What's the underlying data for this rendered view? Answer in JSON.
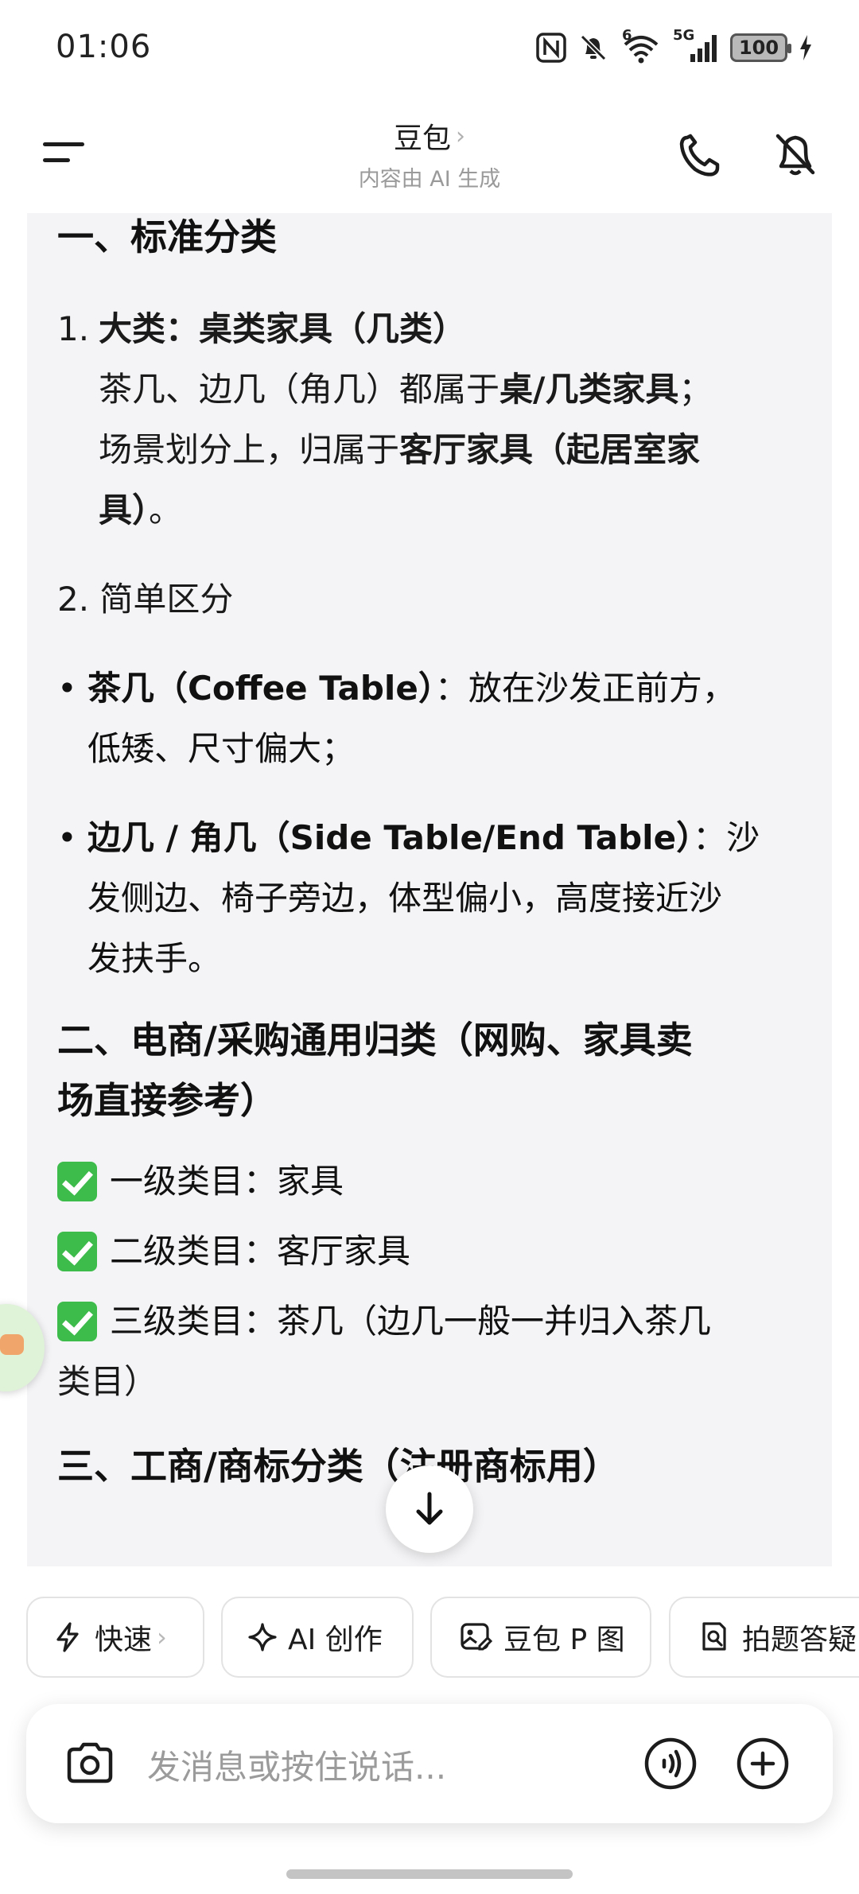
{
  "status_bar": {
    "time": "01:06",
    "battery": "100",
    "network_superscript": "6",
    "network_label": "5G"
  },
  "header": {
    "title": "豆包",
    "title_chevron": "›",
    "subtitle": "内容由 AI 生成"
  },
  "message": {
    "sec1_heading": "一、标准分类",
    "item1_num": "1.",
    "item1_title": "大类：桌类家具（几类）",
    "item1_l2a": "茶几、边几（角几）都属于",
    "item1_l2b": "桌/几类家具",
    "item1_l2c": "；",
    "item1_l3a": "场景划分上，归属于",
    "item1_l3b": "客厅家具（起居室家",
    "item1_l4a": "具）",
    "item1_l4b": "。",
    "item2_text": "2. 简单区分",
    "bullet_symbol": "•",
    "bullet1_bold": "茶几（Coffee Table）",
    "bullet1_rest1": "：放在沙发正前方，",
    "bullet1_rest2": "低矮、尺寸偏大；",
    "bullet2_bold": "边几 / 角几（Side Table/End Table）",
    "bullet2_rest1": "：沙",
    "bullet2_rest2": "发侧边、椅子旁边，体型偏小，高度接近沙",
    "bullet2_rest3": "发扶手。",
    "sec2_heading_l1": "二、电商/采购通用归类（网购、家具卖",
    "sec2_heading_l2": "场直接参考）",
    "check1": "一级类目：家具",
    "check2": "二级类目：客厅家具",
    "check3_l1": "三级类目：茶几（边几一般一并归入茶几",
    "check3_l2": "类目）",
    "sec3_heading": "三、工商/商标分类（注册商标用）"
  },
  "chips": [
    {
      "label": "快速",
      "chevron": "›",
      "icon": "lightning-icon"
    },
    {
      "label": "AI 创作",
      "icon": "sparkle-icon"
    },
    {
      "label": "豆包 P 图",
      "icon": "image-edit-icon"
    },
    {
      "label": "拍题答疑",
      "icon": "doc-search-icon"
    }
  ],
  "input": {
    "placeholder": "发消息或按住说话..."
  },
  "colors": {
    "card_bg": "#f4f4f6",
    "check_green": "#3dbb4b",
    "subtitle_gray": "#9a9a9a"
  }
}
